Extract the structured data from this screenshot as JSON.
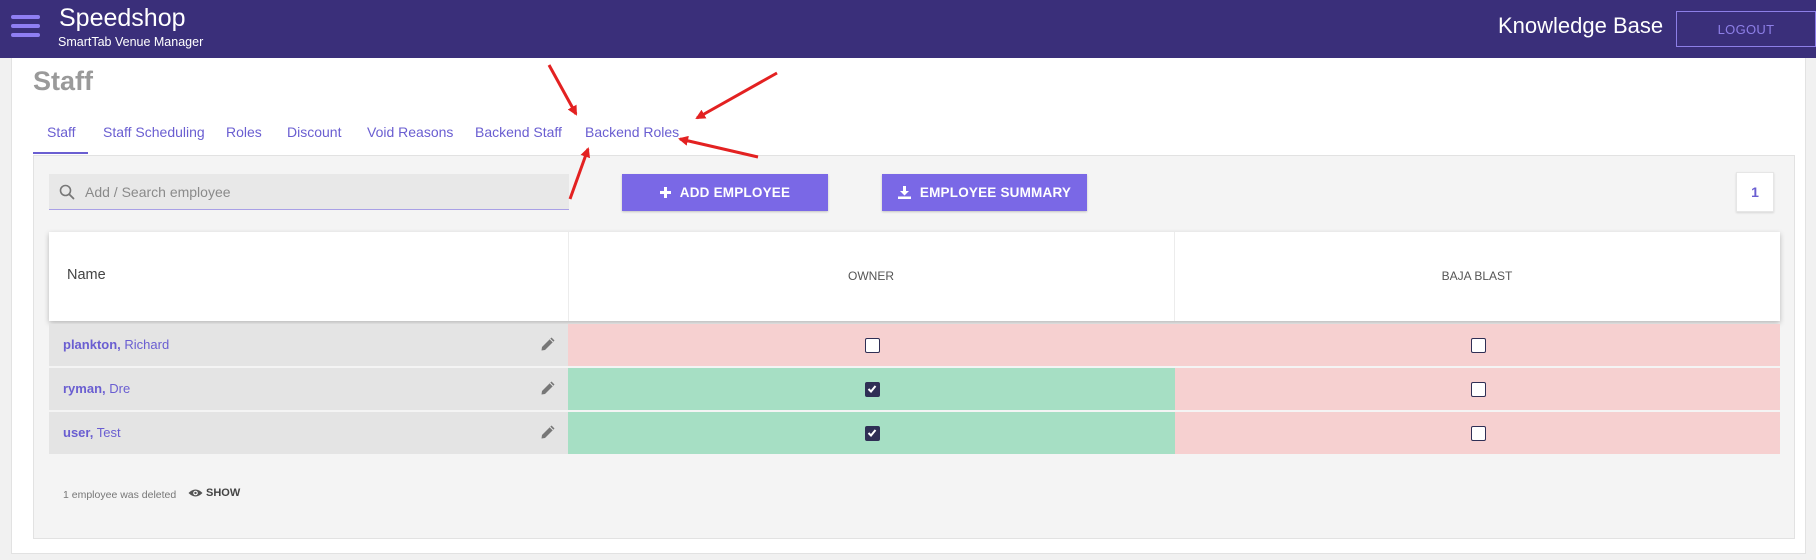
{
  "app": {
    "title": "Speedshop",
    "subtitle": "SmartTab Venue Manager",
    "knowledge_base": "Knowledge Base",
    "logout": "LOGOUT"
  },
  "page": {
    "title": "Staff"
  },
  "tabs": [
    {
      "label": "Staff",
      "active": true
    },
    {
      "label": "Staff Scheduling"
    },
    {
      "label": "Roles"
    },
    {
      "label": "Discount"
    },
    {
      "label": "Void Reasons"
    },
    {
      "label": "Backend Staff"
    },
    {
      "label": "Backend Roles"
    }
  ],
  "search": {
    "placeholder": "Add / Search employee"
  },
  "toolbar": {
    "add_employee": "ADD EMPLOYEE",
    "employee_summary": "EMPLOYEE SUMMARY",
    "page_number": "1"
  },
  "table": {
    "name_header": "Name",
    "columns": [
      "OWNER",
      "BAJA BLAST"
    ],
    "rows": [
      {
        "last": "plankton,",
        "first": "Richard",
        "roles": [
          false,
          false
        ]
      },
      {
        "last": "ryman,",
        "first": "Dre",
        "roles": [
          true,
          false
        ]
      },
      {
        "last": "user,",
        "first": "Test",
        "roles": [
          true,
          false
        ]
      }
    ]
  },
  "footer": {
    "deleted_note": "1 employee was deleted",
    "show_label": "SHOW"
  },
  "colors": {
    "header_bg": "#3a2f7a",
    "accent": "#7a68e6",
    "role_on": "#a6dfc4",
    "role_off": "#f6d0d0",
    "annotation_arrow": "#e32121"
  }
}
